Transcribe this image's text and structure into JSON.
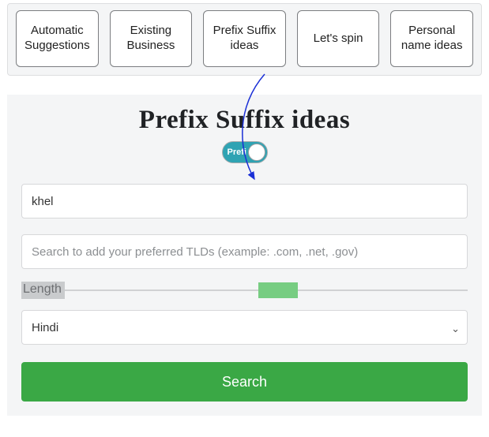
{
  "tabs": [
    {
      "label": "Automatic Suggestions"
    },
    {
      "label": "Existing Business"
    },
    {
      "label": "Prefix Suffix ideas"
    },
    {
      "label": "Let's spin"
    },
    {
      "label": "Personal name ideas"
    }
  ],
  "heading": "Prefix Suffix ideas",
  "toggle": {
    "label": "Prefi"
  },
  "keyword_input": {
    "value": "khel"
  },
  "tld_input": {
    "placeholder": "Search to add your preferred TLDs (example: .com, .net, .gov)"
  },
  "length_label": "Length",
  "language_select": {
    "value": "Hindi"
  },
  "search_button": "Search"
}
